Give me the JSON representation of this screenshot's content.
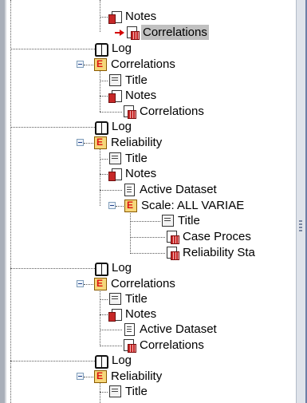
{
  "tree": {
    "items": [
      {
        "label": "Notes",
        "icon": "notes-icon"
      },
      {
        "label": "Correlations",
        "icon": "correlations-table-icon",
        "selected": true
      },
      {
        "label": "Log",
        "icon": "log-icon"
      },
      {
        "label": "Correlations",
        "icon": "heading-icon",
        "expanded": true
      },
      {
        "label": "Title",
        "icon": "title-icon"
      },
      {
        "label": "Notes",
        "icon": "notes-icon"
      },
      {
        "label": "Correlations",
        "icon": "correlations-table-icon"
      },
      {
        "label": "Log",
        "icon": "log-icon"
      },
      {
        "label": "Reliability",
        "icon": "heading-icon",
        "expanded": true
      },
      {
        "label": "Title",
        "icon": "title-icon"
      },
      {
        "label": "Notes",
        "icon": "notes-icon"
      },
      {
        "label": "Active Dataset",
        "icon": "active-dataset-icon"
      },
      {
        "label": "Scale: ALL VARIAE",
        "icon": "heading-icon",
        "expanded": true
      },
      {
        "label": "Title",
        "icon": "title-icon"
      },
      {
        "label": "Case Proces",
        "icon": "table-icon"
      },
      {
        "label": "Reliability Sta",
        "icon": "table-icon"
      },
      {
        "label": "Log",
        "icon": "log-icon"
      },
      {
        "label": "Correlations",
        "icon": "heading-icon",
        "expanded": true
      },
      {
        "label": "Title",
        "icon": "title-icon"
      },
      {
        "label": "Notes",
        "icon": "notes-icon"
      },
      {
        "label": "Active Dataset",
        "icon": "active-dataset-icon"
      },
      {
        "label": "Correlations",
        "icon": "correlations-table-icon"
      },
      {
        "label": "Log",
        "icon": "log-icon"
      },
      {
        "label": "Reliability",
        "icon": "heading-icon",
        "expanded": true
      },
      {
        "label": "Title",
        "icon": "title-icon"
      }
    ]
  },
  "colors": {
    "selection": "#c0c0c0",
    "arrow": "#d40000",
    "frame": "#6d7ea6"
  }
}
